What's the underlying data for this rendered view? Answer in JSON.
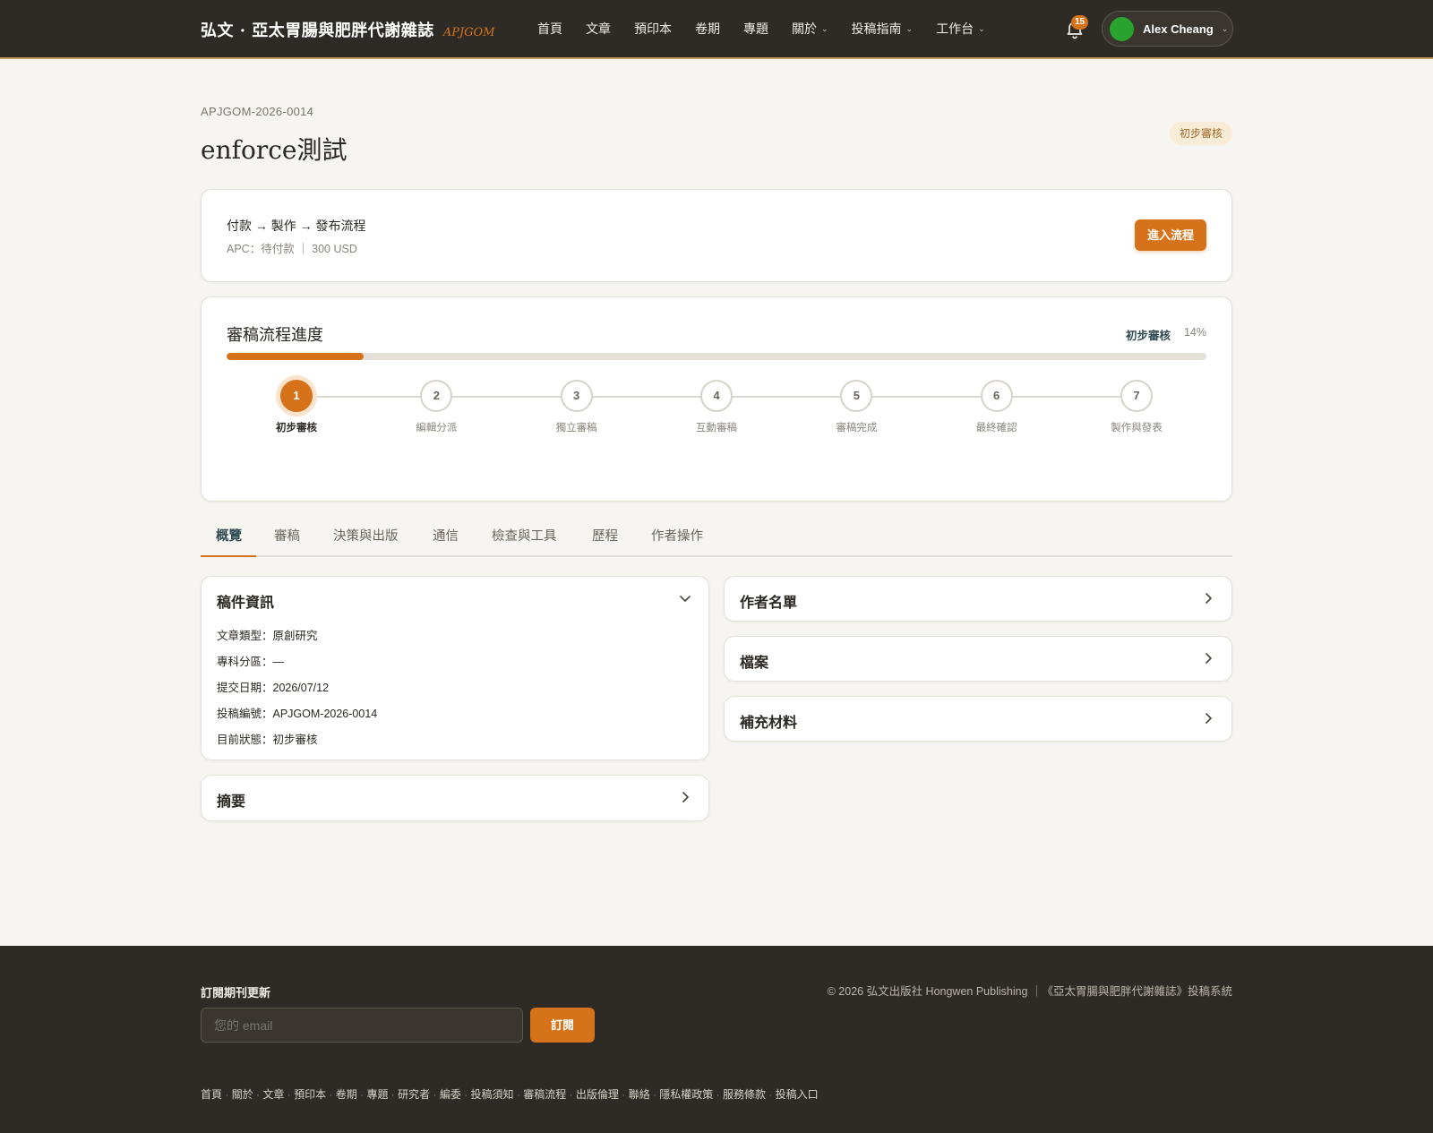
{
  "header": {
    "brand_title": "弘文 · 亞太胃腸與肥胖代謝雜誌",
    "brand_abbr": "APJGOM",
    "nav": [
      {
        "label": "首頁",
        "dropdown": false
      },
      {
        "label": "文章",
        "dropdown": false
      },
      {
        "label": "預印本",
        "dropdown": false
      },
      {
        "label": "卷期",
        "dropdown": false
      },
      {
        "label": "專題",
        "dropdown": false
      },
      {
        "label": "關於",
        "dropdown": true
      },
      {
        "label": "投稿指南",
        "dropdown": true
      },
      {
        "label": "工作台",
        "dropdown": true
      }
    ],
    "notification_count": "15",
    "user_name": "Alex Cheang"
  },
  "manuscript": {
    "id": "APJGOM-2026-0014",
    "title": "enforce測試",
    "status_badge": "初步審核"
  },
  "workflow": {
    "title": "付款 → 製作 → 發布流程",
    "subtitle": "APC：待付款 ｜ 300 USD",
    "button": "進入流程"
  },
  "progress": {
    "title": "審稿流程進度",
    "current_stage": "初步審核",
    "percent_label": "14%",
    "percent": 14,
    "steps": [
      {
        "num": "1",
        "label": "初步審核",
        "active": true
      },
      {
        "num": "2",
        "label": "編輯分派",
        "active": false
      },
      {
        "num": "3",
        "label": "獨立審稿",
        "active": false
      },
      {
        "num": "4",
        "label": "互動審稿",
        "active": false
      },
      {
        "num": "5",
        "label": "審稿完成",
        "active": false
      },
      {
        "num": "6",
        "label": "最終確認",
        "active": false
      },
      {
        "num": "7",
        "label": "製作與發表",
        "active": false
      }
    ]
  },
  "tabs": [
    "概覽",
    "審稿",
    "決策與出版",
    "通信",
    "檢查與工具",
    "歷程",
    "作者操作"
  ],
  "panels": {
    "info": {
      "title": "稿件資訊",
      "rows": [
        "文章類型：原創研究",
        "專科分區：—",
        "提交日期：2026/07/12",
        "投稿編號：APJGOM-2026-0014",
        "目前狀態：初步審核"
      ]
    },
    "abstract": "摘要",
    "authors": "作者名單",
    "files": "檔案",
    "supplementary": "補充材料"
  },
  "footer": {
    "subscribe_title": "訂閱期刊更新",
    "email_placeholder": "您的 email",
    "subscribe_button": "訂閱",
    "copyright": "© 2026 弘文出版社 Hongwen Publishing ｜《亞太胃腸與肥胖代謝雜誌》投稿系統",
    "links": [
      "首頁",
      "關於",
      "文章",
      "預印本",
      "卷期",
      "專題",
      "研究者",
      "編委",
      "投稿須知",
      "審稿流程",
      "出版倫理",
      "聯絡",
      "隱私權政策",
      "服務條款",
      "投稿入口"
    ]
  },
  "colors": {
    "header_bg": "#2e2b26",
    "accent": "#d6731a",
    "page_bg": "#f6f5f2",
    "tab_active": "#2f4a52"
  }
}
